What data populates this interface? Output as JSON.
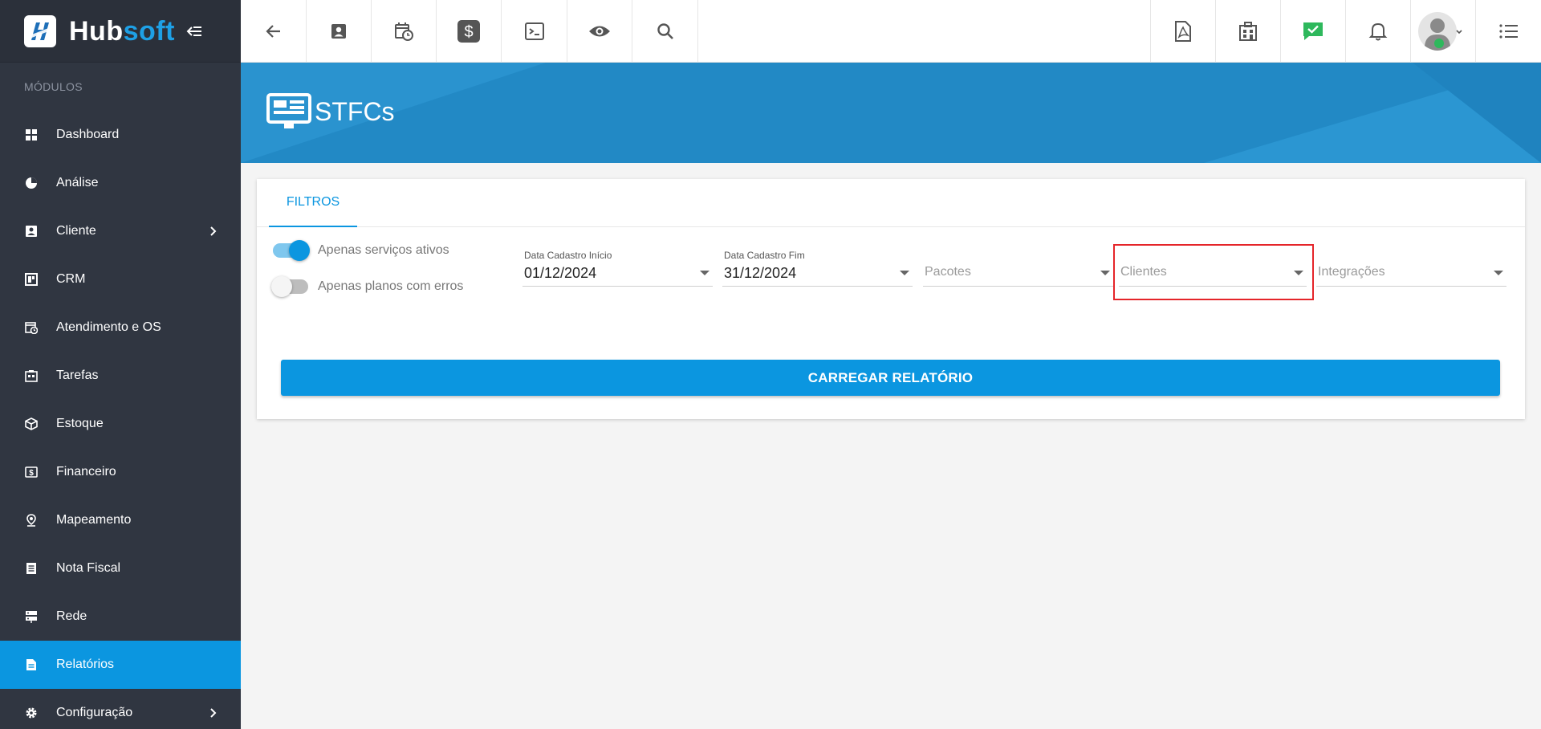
{
  "app": {
    "logo_text_part1": "Hub",
    "logo_text_part2": "soft"
  },
  "sidebar": {
    "section_title": "MÓDULOS",
    "items": [
      {
        "label": "Dashboard",
        "icon": "dashboard-icon"
      },
      {
        "label": "Análise",
        "icon": "pie-chart-icon"
      },
      {
        "label": "Cliente",
        "icon": "contact-card-icon",
        "has_submenu": true
      },
      {
        "label": "CRM",
        "icon": "crm-icon"
      },
      {
        "label": "Atendimento e OS",
        "icon": "calendar-clock-icon"
      },
      {
        "label": "Tarefas",
        "icon": "tasks-icon"
      },
      {
        "label": "Estoque",
        "icon": "box-icon"
      },
      {
        "label": "Financeiro",
        "icon": "money-icon"
      },
      {
        "label": "Mapeamento",
        "icon": "map-pin-icon"
      },
      {
        "label": "Nota Fiscal",
        "icon": "invoice-icon"
      },
      {
        "label": "Rede",
        "icon": "server-icon"
      },
      {
        "label": "Relatórios",
        "icon": "report-icon",
        "active": true
      },
      {
        "label": "Configuração",
        "icon": "gear-icon",
        "has_submenu": true
      }
    ]
  },
  "topbar": {
    "left_icons": [
      "back-arrow-icon",
      "contact-icon",
      "calendar-clock-icon",
      "dollar-icon",
      "terminal-icon",
      "eye-icon",
      "search-icon"
    ],
    "right_icons": [
      "pdf-icon",
      "building-icon",
      "chat-check-icon",
      "bell-icon",
      "avatar",
      "menu-list-icon"
    ]
  },
  "page": {
    "title": "STFCs",
    "icon": "report-monitor-icon"
  },
  "filters": {
    "tab_label": "FILTROS",
    "toggle_active_services": {
      "label": "Apenas serviços ativos",
      "checked": true
    },
    "toggle_plans_errors": {
      "label": "Apenas planos com erros",
      "checked": false
    },
    "date_start": {
      "label": "Data Cadastro Início",
      "value": "01/12/2024"
    },
    "date_end": {
      "label": "Data Cadastro Fim",
      "value": "31/12/2024"
    },
    "packages": {
      "placeholder": "Pacotes"
    },
    "clients": {
      "placeholder": "Clientes"
    },
    "integrations": {
      "placeholder": "Integrações"
    },
    "load_button": "CARREGAR RELATÓRIO"
  },
  "colors": {
    "sidebar_bg": "#303641",
    "accent": "#0b96e0",
    "banner": "#2289c5",
    "highlight": "#e5252a"
  }
}
